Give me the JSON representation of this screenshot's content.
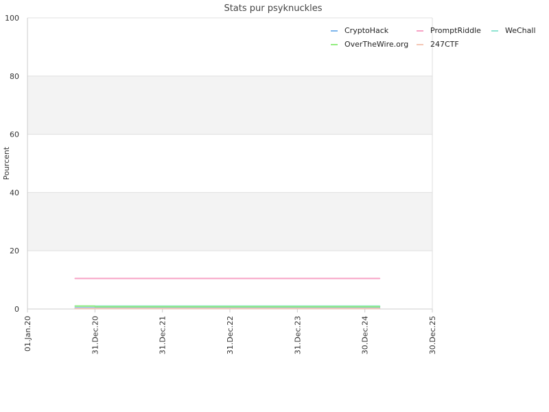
{
  "chart_data": {
    "type": "line",
    "title": "Stats pur psyknuckles",
    "ylabel": "Pourcent",
    "xlabel": "",
    "ylim": [
      0,
      100
    ],
    "yticks": [
      0,
      20,
      40,
      60,
      80,
      100
    ],
    "xlim": [
      "2020-01-01",
      "2025-12-30"
    ],
    "xticks": [
      {
        "date": "2020-01-01",
        "label": "01.Jan.20"
      },
      {
        "date": "2020-12-31",
        "label": "31.Dec.20"
      },
      {
        "date": "2021-12-31",
        "label": "31.Dec.21"
      },
      {
        "date": "2022-12-31",
        "label": "31.Dec.22"
      },
      {
        "date": "2023-12-31",
        "label": "31.Dec.23"
      },
      {
        "date": "2024-12-30",
        "label": "30.Dec.24"
      },
      {
        "date": "2025-12-30",
        "label": "30.Dec.25"
      }
    ],
    "grid": "alternating horizontal bands",
    "legend_position": "top-right",
    "series": [
      {
        "name": "CryptoHack",
        "color": "#7cb5ec",
        "points": [
          {
            "x": "2020-09-15",
            "y": 0.4
          },
          {
            "x": "2020-12-31",
            "y": 0.4
          },
          {
            "x": "2021-01-01",
            "y": 0.5
          },
          {
            "x": "2025-03-20",
            "y": 0.5
          }
        ]
      },
      {
        "name": "PromptRiddle",
        "color": "#f7a1c4",
        "points": [
          {
            "x": "2020-09-15",
            "y": 10.5
          },
          {
            "x": "2025-03-20",
            "y": 10.5
          }
        ]
      },
      {
        "name": "WeChall",
        "color": "#8ee3d1",
        "points": [
          {
            "x": "2020-09-15",
            "y": 1.0
          },
          {
            "x": "2025-03-20",
            "y": 1.0
          }
        ]
      },
      {
        "name": "OverTheWire.org",
        "color": "#90ed7d",
        "points": [
          {
            "x": "2020-09-15",
            "y": 1.0
          },
          {
            "x": "2020-12-31",
            "y": 1.0
          },
          {
            "x": "2021-01-01",
            "y": 0.8
          },
          {
            "x": "2025-03-20",
            "y": 0.8
          }
        ]
      },
      {
        "name": "247CTF",
        "color": "#f4c6b4",
        "points": [
          {
            "x": "2020-09-15",
            "y": 0.2
          },
          {
            "x": "2025-03-20",
            "y": 0.2
          }
        ]
      }
    ]
  }
}
